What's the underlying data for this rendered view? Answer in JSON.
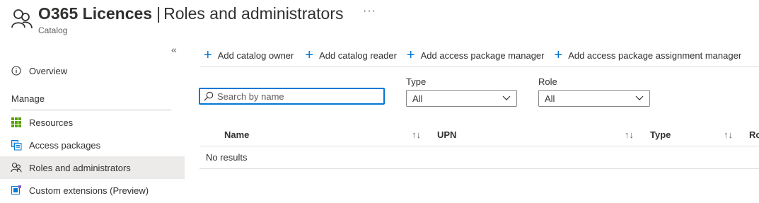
{
  "header": {
    "title_main": "O365 Licences",
    "title_sep": "|",
    "title_sub": "Roles and administrators",
    "more": "···",
    "subtitle": "Catalog",
    "icon": "people-icon"
  },
  "sidebar": {
    "collapse": "«",
    "overview": {
      "label": "Overview",
      "icon": "info-icon"
    },
    "section": "Manage",
    "items": [
      {
        "label": "Resources",
        "icon": "grid-icon"
      },
      {
        "label": "Access packages",
        "icon": "package-icon"
      },
      {
        "label": "Roles and administrators",
        "icon": "people-icon",
        "active": true
      },
      {
        "label": "Custom extensions (Preview)",
        "icon": "extension-icon"
      }
    ]
  },
  "toolbar": {
    "buttons": [
      "Add catalog owner",
      "Add catalog reader",
      "Add access package manager",
      "Add access package assignment manager"
    ]
  },
  "search": {
    "placeholder": "Search by name",
    "value": ""
  },
  "filters": {
    "type": {
      "label": "Type",
      "value": "All"
    },
    "role": {
      "label": "Role",
      "value": "All"
    }
  },
  "table": {
    "columns": [
      "Name",
      "UPN",
      "Type",
      "Ro"
    ],
    "sort_glyph": "↑↓",
    "empty": "No results"
  },
  "colors": {
    "accent": "#0078d4",
    "active_bg": "#edebe9"
  }
}
